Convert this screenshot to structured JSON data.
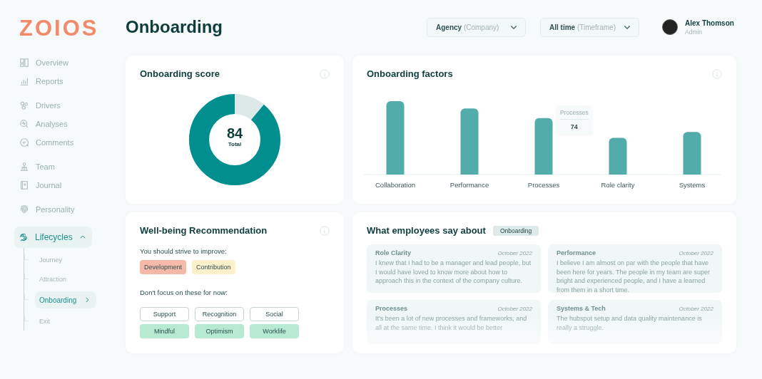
{
  "logo": "ZOIOS",
  "header": {
    "title": "Onboarding",
    "filters": [
      {
        "value": "Agency",
        "hint": "(Company)"
      },
      {
        "value": "All time",
        "hint": "(Timeframe)"
      }
    ],
    "user": {
      "name": "Alex Thomson",
      "role": "Admin"
    }
  },
  "sidebar": {
    "groups": [
      {
        "items": [
          {
            "label": "Overview",
            "selected": false
          },
          {
            "label": "Reports",
            "selected": false
          }
        ]
      },
      {
        "items": [
          {
            "label": "Drivers",
            "selected": false
          },
          {
            "label": "Analyses",
            "selected": false
          },
          {
            "label": "Comments",
            "selected": false
          }
        ]
      },
      {
        "items": [
          {
            "label": "Team",
            "selected": false
          },
          {
            "label": "Journal",
            "selected": false
          }
        ]
      },
      {
        "items": [
          {
            "label": "Personality",
            "selected": false
          }
        ]
      },
      {
        "items": [
          {
            "label": "Lifecycles",
            "selected": true,
            "expanded": true,
            "children": [
              {
                "label": "Journey",
                "selected": false
              },
              {
                "label": "Attraction",
                "selected": false
              },
              {
                "label": "Onboarding",
                "selected": true
              },
              {
                "label": "Exit",
                "selected": false
              }
            ]
          }
        ]
      }
    ]
  },
  "score_card": {
    "title": "Onboarding score",
    "score": "84",
    "score_label": "Total",
    "level": 0.89
  },
  "factors_card": {
    "title": "Onboarding factors",
    "categories": [
      "Collaboration",
      "Performance",
      "Processes",
      "Role clarity",
      "Systems"
    ],
    "tooltip": {
      "category": "Processes",
      "value": "74"
    }
  },
  "wellbeing_card": {
    "title": "Well-being Recommendation",
    "improve_label": "You should strive to improve:",
    "improve": [
      {
        "label": "Development",
        "kind": "filled",
        "color": "#f6b9a9"
      },
      {
        "label": "Contribution",
        "kind": "filled",
        "color": "#fdf1cd"
      }
    ],
    "ignore_label": "Don't focus on these for now:",
    "ignore": [
      {
        "label": "Support",
        "kind": "outline",
        "color": "#ffffff"
      },
      {
        "label": "Recognition",
        "kind": "outline",
        "color": "#ffffff"
      },
      {
        "label": "Social",
        "kind": "outline",
        "color": "#ffffff"
      },
      {
        "label": "Mindful",
        "kind": "filled",
        "color": "#b7ead2"
      },
      {
        "label": "Optimism",
        "kind": "filled",
        "color": "#b7ead2"
      },
      {
        "label": "Worklife",
        "kind": "filled",
        "color": "#b7ead2"
      }
    ]
  },
  "comments_card": {
    "title": "What employees say about",
    "topic": "Onboarding",
    "comments": [
      {
        "topic": "Role Clarity",
        "date": "October 2022",
        "text": "I knew that I had to be a manager and lead people, but I would have loved to know more about how to approach this in the context of the company culture."
      },
      {
        "topic": "Performance",
        "date": "October 2022",
        "text": "I believe I am almost on par with the people that have been here for years. The people in my team are super bright and experienced people, and I have a learned from them in a short time."
      },
      {
        "topic": "Processes",
        "date": "October 2022",
        "text": "It's been a lot of new processes and frameworks, and all at the same time. I think it would be better"
      },
      {
        "topic": "Systems & Tech",
        "date": "October 2022",
        "text": "The hubspot setup and data quality maintenance is really a struggle."
      }
    ]
  }
}
